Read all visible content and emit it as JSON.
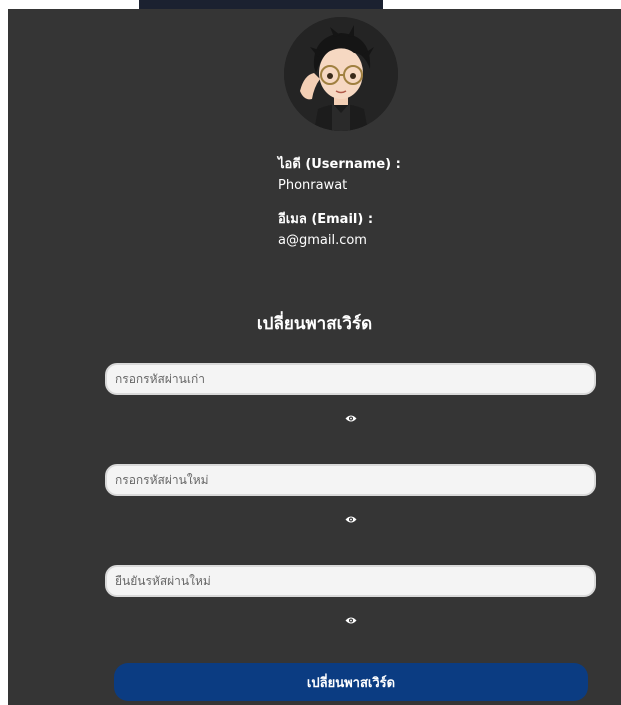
{
  "profile": {
    "avatar_icon": "avatar-image",
    "username_label": "ไอดี (Username) :",
    "username_value": "Phonrawat",
    "email_label": "อีเมล (Email) :",
    "email_value": "a@gmail.com"
  },
  "change_password": {
    "title": "เปลี่ยนพาสเวิร์ด",
    "old_password_placeholder": "กรอกรหัสผ่านเก่า",
    "new_password_placeholder": "กรอกรหัสผ่านใหม่",
    "confirm_password_placeholder": "ยืนยันรหัสผ่านใหม่",
    "toggle_icon": "eye-icon",
    "submit_label": "เปลี่ยนพาสเวิร์ด"
  },
  "colors": {
    "panel_bg": "#353535",
    "button_bg": "#0b3c82",
    "input_bg": "#f4f4f4"
  }
}
